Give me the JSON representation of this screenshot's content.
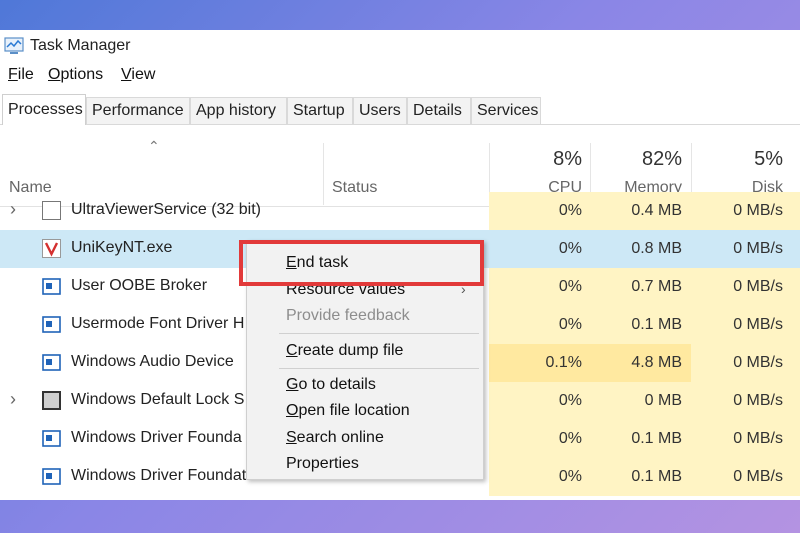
{
  "window": {
    "title": "Task Manager"
  },
  "menu": [
    "File",
    "Options",
    "View"
  ],
  "tabs": [
    "Processes",
    "Performance",
    "App history",
    "Startup",
    "Users",
    "Details",
    "Services"
  ],
  "header": {
    "name": "Name",
    "status": "Status",
    "cpu_pct": "8%",
    "cpu_label": "CPU",
    "mem_pct": "82%",
    "mem_label": "Memory",
    "disk_pct": "5%",
    "disk_label": "Disk"
  },
  "rows": [
    {
      "name": "UltraViewerService (32 bit)",
      "cpu": "0%",
      "memory": "0.4 MB",
      "disk": "0 MB/s",
      "icon": "service-icon"
    },
    {
      "name": "UniKeyNT.exe",
      "cpu": "0%",
      "memory": "0.8 MB",
      "disk": "0 MB/s",
      "icon": "unikey-icon"
    },
    {
      "name": "User OOBE Broker",
      "cpu": "0%",
      "memory": "0.7 MB",
      "disk": "0 MB/s",
      "icon": "app-window-icon"
    },
    {
      "name": "Usermode Font Driver H",
      "cpu": "0%",
      "memory": "0.1 MB",
      "disk": "0 MB/s",
      "icon": "app-window-icon"
    },
    {
      "name": "Windows Audio Device",
      "cpu": "0.1%",
      "memory": "4.8 MB",
      "disk": "0 MB/s",
      "icon": "app-window-icon"
    },
    {
      "name": "Windows Default Lock S",
      "cpu": "0%",
      "memory": "0 MB",
      "disk": "0 MB/s",
      "icon": "lock-screen-icon"
    },
    {
      "name": "Windows Driver Founda",
      "cpu": "0%",
      "memory": "0.1 MB",
      "disk": "0 MB/s",
      "icon": "app-window-icon"
    },
    {
      "name": "Windows Driver Foundation - U...",
      "cpu": "0%",
      "memory": "0.1 MB",
      "disk": "0 MB/s",
      "icon": "app-window-icon"
    }
  ],
  "context_menu": {
    "end_task": "End task",
    "resource_values": "Resource values",
    "provide_feedback": "Provide feedback",
    "create_dump": "Create dump file",
    "go_to_details": "Go to details",
    "open_file_location": "Open file location",
    "search_online": "Search online",
    "properties": "Properties"
  },
  "colors": {
    "heat_light": "#fff4c4",
    "heat_medium": "#ffe9a0",
    "selected_row": "#cde8f6",
    "highlight_border": "#e23a3a"
  }
}
